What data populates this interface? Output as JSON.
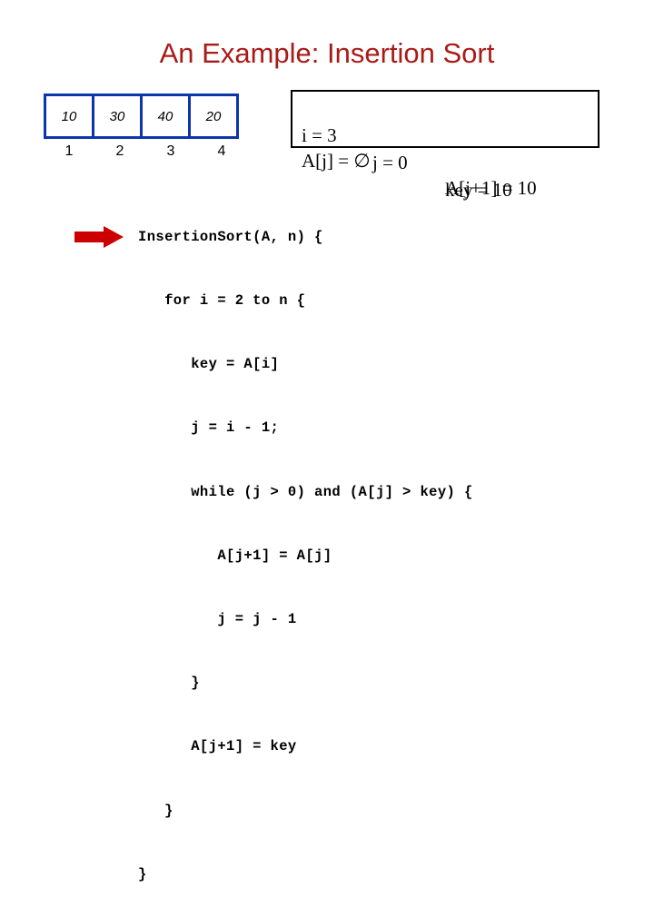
{
  "slide": {
    "title": "An Example: Insertion Sort",
    "title_color": "#a81c18",
    "background": "#ffffff"
  },
  "array_table": {
    "border_color": "#0b35a8",
    "values": [
      "10",
      "30",
      "40",
      "20"
    ],
    "indices": [
      "1",
      "2",
      "3",
      "4"
    ]
  },
  "status_box": {
    "border_color": "#000000",
    "line1": {
      "i": "i = 3",
      "j": "j = 0",
      "key": "key = 10"
    },
    "line2": {
      "a_j": "A[j] = ∅",
      "a_j_plus_1": "A[j+1] = 10"
    }
  },
  "pointer": {
    "icon": "right-arrow-icon",
    "color": "#cc0000"
  },
  "code": {
    "lines": [
      "InsertionSort(A, n) {",
      "   for i = 2 to n {",
      "      key = A[i]",
      "      j = i - 1;",
      "      while (j > 0) and (A[j] > key) {",
      "         A[j+1] = A[j]",
      "         j = j - 1",
      "      }",
      "      A[j+1] = key",
      "   }",
      "}"
    ]
  }
}
